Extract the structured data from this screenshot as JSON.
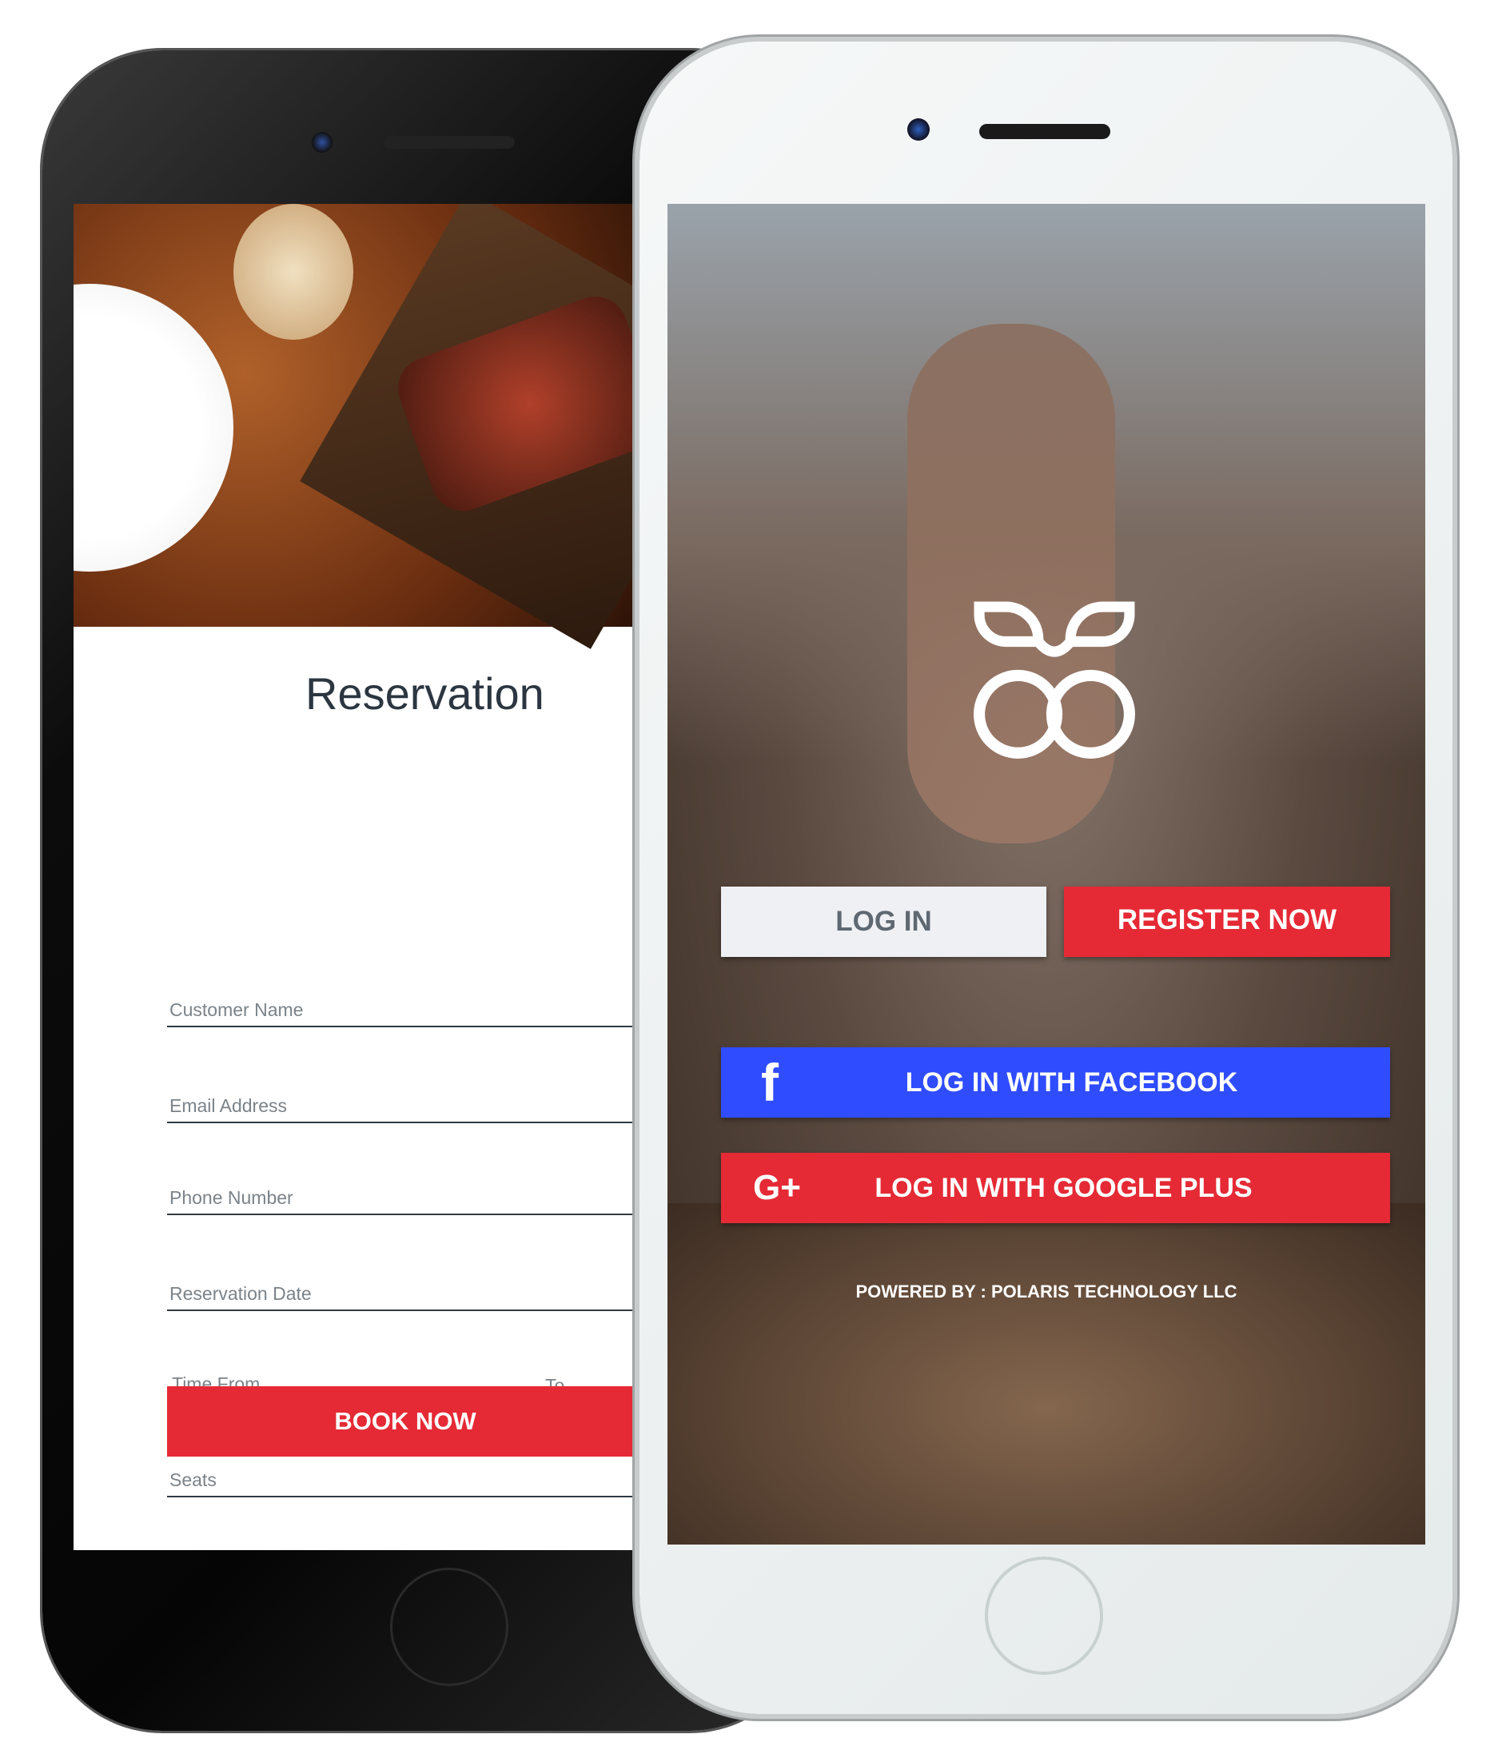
{
  "reservation": {
    "title": "Reservation",
    "fields": {
      "customer_name": "Customer Name",
      "email": "Email Address",
      "phone": "Phone Number",
      "date": "Reservation Date",
      "time_from": "Time From",
      "time_to": "To",
      "seats": "Seats"
    },
    "book_button": "BOOK NOW"
  },
  "login": {
    "login_button": "LOG IN",
    "register_button": "REGISTER NOW",
    "facebook_button": "LOG IN WITH FACEBOOK",
    "google_button": "LOG IN WITH GOOGLE PLUS",
    "facebook_icon": "f",
    "google_icon": "G+",
    "powered_by": "POWERED BY : POLARIS TECHNOLOGY LLC"
  },
  "colors": {
    "accent_red": "#e52a35",
    "facebook_blue": "#2f4cff",
    "login_grey": "#eff0f4"
  }
}
